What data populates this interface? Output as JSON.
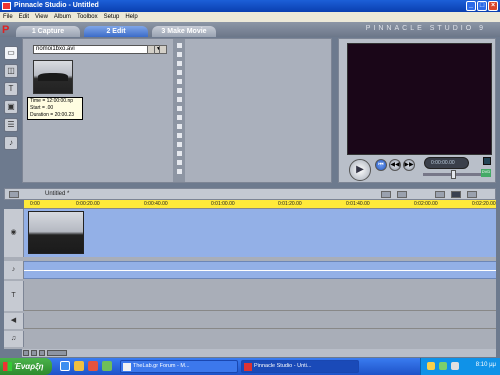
{
  "window": {
    "title": "Pinnacle Studio - Untitled"
  },
  "menu": [
    "File",
    "Edit",
    "View",
    "Album",
    "Toolbox",
    "Setup",
    "Help"
  ],
  "tabs": [
    {
      "label": "1 Capture",
      "active": false
    },
    {
      "label": "2 Edit",
      "active": true
    },
    {
      "label": "3 Make Movie",
      "active": false
    }
  ],
  "brand": "PINNACLE STUDIO 9",
  "album": {
    "file_dropdown": "nomoi1bxo.avi",
    "tooltip": {
      "time": "Time = 12:00:00.np",
      "start": "Start = .00",
      "duration": "Duration = 20:00.23"
    }
  },
  "player": {
    "counter": "0:00:00.00"
  },
  "timeline": {
    "title": "Untitled *",
    "ruler": [
      "0:00",
      "0:00:20.00",
      "0:00:40.00",
      "0:01:00.00",
      "0:01:20.00",
      "0:01:40.00",
      "0:02:00.00",
      "0:02:20.00"
    ]
  },
  "taskbar": {
    "start_label": "Έναρξη",
    "tasks": [
      {
        "label": "TheLab.gr Forum - M...",
        "active": false
      },
      {
        "label": "Pinnacle Studio - Unti...",
        "active": true
      }
    ],
    "clock": "8:10 μμ"
  },
  "colors": {
    "accent": "#3c6cc9",
    "timeline_track": "#93b0e7",
    "ruler": "#ffea3a"
  }
}
